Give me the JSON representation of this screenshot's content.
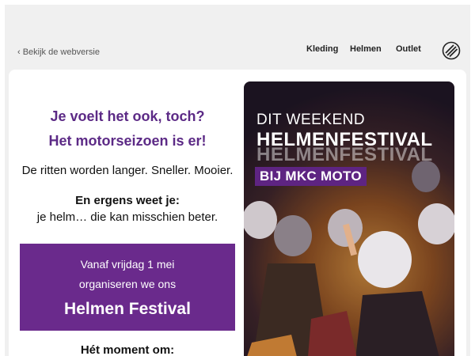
{
  "header": {
    "webversie_link": "‹ Bekijk de webversie",
    "nav": [
      {
        "label": "Kleding"
      },
      {
        "label": "Helmen"
      },
      {
        "label": "Outlet"
      }
    ],
    "logo_icon": "brand-logo-icon"
  },
  "intro": {
    "headline_line1": "Je voelt het ook, toch?",
    "headline_line2": "Het motorseizoen is er!",
    "text1": "De ritten worden langer. Sneller. Mooier.",
    "text2_strong": "En ergens weet je:",
    "text2": "je helm… die kan misschien beter."
  },
  "festival_box": {
    "line1": "Vanaf vrijdag 1 mei",
    "line2": "organiseren we ons",
    "title": "Helmen Festival"
  },
  "moment_heading": "Hét moment om:",
  "promo": {
    "subtitle": "DIT WEEKEND",
    "title": "HELMENFESTIVAL",
    "badge": "BIJ MKC MOTO"
  },
  "colors": {
    "brand_purple": "#6a2a8c",
    "headline_purple": "#5c2a86",
    "background": "#f0f0f0"
  }
}
